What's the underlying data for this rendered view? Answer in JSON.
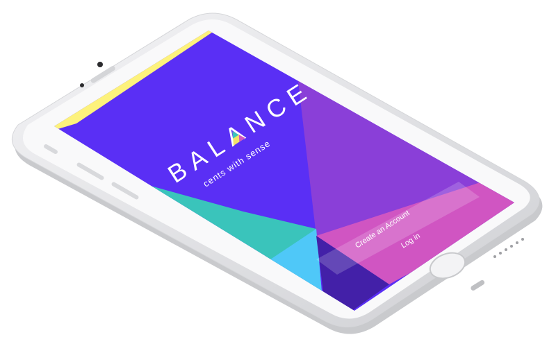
{
  "app": {
    "brand": "BALANCE",
    "tagline": "cents with sense"
  },
  "actions": {
    "create_account_label": "Create an Account",
    "login_label": "Log in"
  },
  "colors": {
    "screen_purple": "#5a2ff5",
    "right_purple": "#8a3fd8",
    "yellow": "#fdf27c",
    "teal": "#3ac4bb",
    "cyan": "#4fc8f8",
    "pink": "#d055c2",
    "dark_purple": "#4320a8",
    "phone_body": "#e6e7ea",
    "phone_bezel": "#f8f8f8"
  }
}
